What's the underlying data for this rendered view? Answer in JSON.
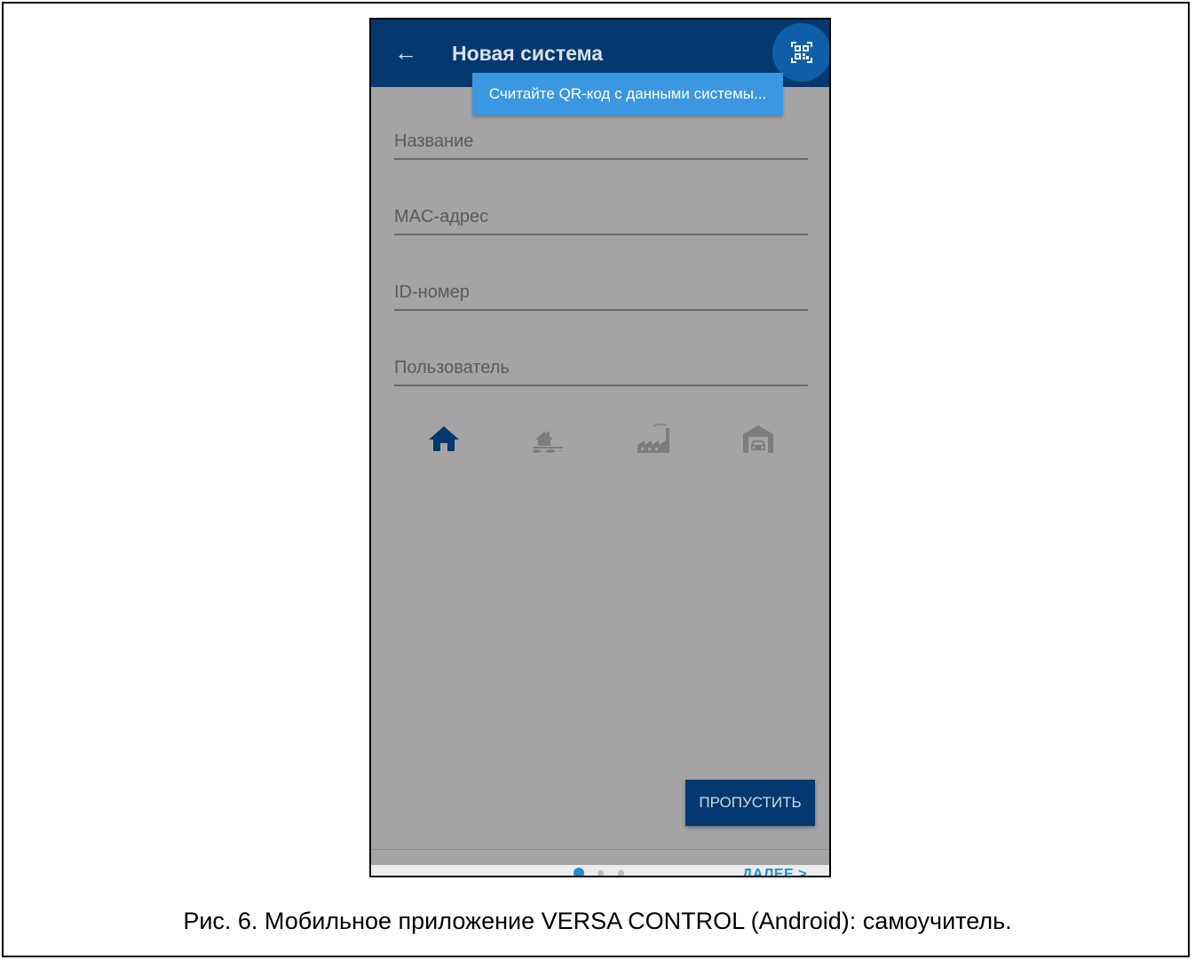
{
  "appbar": {
    "title": "Новая система",
    "back_icon": "arrow-left-icon",
    "qr_icon": "qr-code-icon"
  },
  "tooltip": {
    "text": "Считайте QR-код с данными системы..."
  },
  "form": {
    "fields": [
      {
        "placeholder": "Название",
        "value": ""
      },
      {
        "placeholder": "MAC-адрес",
        "value": ""
      },
      {
        "placeholder": "ID-номер",
        "value": ""
      },
      {
        "placeholder": "Пользователь",
        "value": ""
      }
    ],
    "type_icons": [
      "house-icon",
      "lake-house-icon",
      "factory-icon",
      "garage-icon"
    ],
    "selected_type_index": 0
  },
  "buttons": {
    "skip": "ПРОПУСТИТЬ",
    "next": "ДАЛЕЕ >"
  },
  "pager": {
    "current": 1,
    "total": 3
  },
  "caption": "Рис. 6. Мобильное приложение VERSA CONTROL (Android): самоучитель.",
  "colors": {
    "appbar": "#03396f",
    "accent": "#3b98e0",
    "overlay": "#a4a4a4",
    "active_icon": "#03396f",
    "inactive_icon": "#7d7d7d"
  }
}
